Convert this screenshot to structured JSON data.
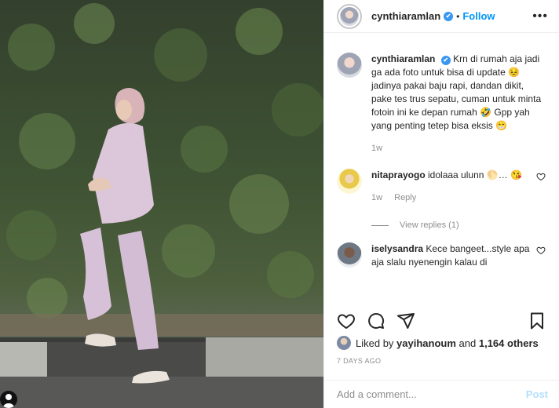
{
  "header": {
    "username": "cynthiaramlan",
    "verified_mark": "✔",
    "separator": "•",
    "follow_label": "Follow",
    "more_label": "•••"
  },
  "caption": {
    "username": "cynthiaramlan",
    "text": "Krn di rumah aja jadi ga ada foto untuk bisa di update 😣 jadinya pakai baju rapi, dandan dikit, pake tes trus sepatu, cuman untuk minta fotoin ini ke depan rumah 🤣 Gpp yah yang penting tetep bisa eksis 😁",
    "age": "1w"
  },
  "comments": [
    {
      "username": "nitaprayogo",
      "text": "idolaaa ulunn 🌕… 😘",
      "age": "1w",
      "reply_label": "Reply",
      "view_replies": "View replies (1)"
    },
    {
      "username": "iselysandra",
      "text": "Kece bangeet...style apa aja slalu nyenengin kalau di"
    }
  ],
  "likes": {
    "prefix": "Liked by",
    "user": "yayihanoum",
    "connector": "and",
    "count_text": "1,164 others"
  },
  "date": "7 DAYS AGO",
  "add_comment": {
    "placeholder": "Add a comment...",
    "post_label": "Post"
  },
  "icons": {
    "like": "heart-icon",
    "comment": "comment-icon",
    "share": "share-icon",
    "save": "bookmark-icon",
    "comment_like": "small-heart-icon"
  },
  "colors": {
    "link_blue": "#0095f6",
    "muted": "#8e8e8e",
    "post_disabled": "#b2dffc"
  }
}
